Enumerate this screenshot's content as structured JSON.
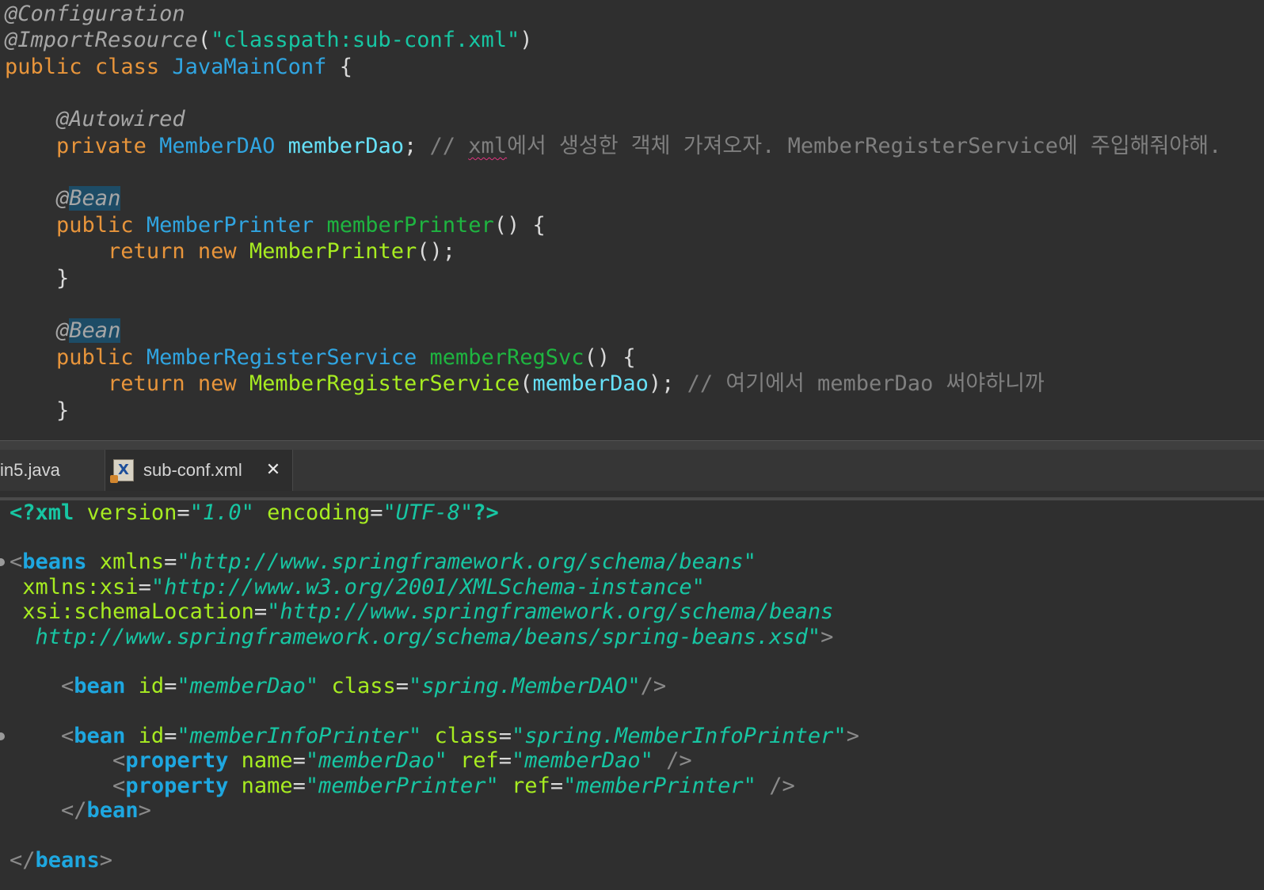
{
  "java": {
    "l1": {
      "ann": "@Configuration"
    },
    "l2": {
      "ann": "@ImportResource",
      "p1": "(",
      "str": "\"classpath:sub-conf.xml\"",
      "p2": ")"
    },
    "l3": {
      "kw1": "public",
      "kw2": "class",
      "type": "JavaMainConf",
      "brace": "{"
    },
    "l4": {
      "ann": "@Autowired"
    },
    "l5": {
      "kw": "private",
      "type": "MemberDAO",
      "fld": "memberDao",
      "semi": ";",
      "cmt_pre": "// ",
      "cmt_squig": "xml",
      "cmt_post": "에서 생성한 객체 가져오자. MemberRegisterService에 주입해줘야해."
    },
    "l6": {
      "at": "@",
      "name": "Bean"
    },
    "l7": {
      "kw": "public",
      "type": "MemberPrinter",
      "mth": "memberPrinter",
      "rest": "() {"
    },
    "l8": {
      "kw1": "return",
      "kw2": "new",
      "ctor": "MemberPrinter",
      "rest": "();"
    },
    "l9": {
      "brace": "}"
    },
    "l10": {
      "at": "@",
      "name": "Bean"
    },
    "l11": {
      "kw": "public",
      "type": "MemberRegisterService",
      "mth": "memberRegSvc",
      "rest": "() {"
    },
    "l12": {
      "kw1": "return",
      "kw2": "new",
      "ctor": "MemberRegisterService",
      "p1": "(",
      "fld": "memberDao",
      "p2": ");",
      "cmt": "// 여기에서 memberDao 써야하니까"
    },
    "l13": {
      "brace": "}"
    }
  },
  "tabs": {
    "inactive_label": "in5.java",
    "active_label": "sub-conf.xml",
    "active_icon": "xml-file-icon",
    "close_icon": "close-icon"
  },
  "xml": {
    "decl": {
      "open": "<?",
      "tag": "xml",
      "a1": "version",
      "v1": "\"1.0\"",
      "a2": "encoding",
      "v2": "\"UTF-8\"",
      "close": "?>"
    },
    "beans_open": {
      "lt": "<",
      "tag": "beans",
      "a1": "xmlns",
      "v1": "\"http://www.springframework.org/schema/beans\""
    },
    "xsi": {
      "a": "xmlns:xsi",
      "v": "\"http://www.w3.org/2001/XMLSchema-instance\""
    },
    "schema": {
      "a": "xsi:schemaLocation",
      "v": "\"http://www.springframework.org/schema/beans"
    },
    "schema2": {
      "v": "http://www.springframework.org/schema/beans/spring-beans.xsd\"",
      "gt": ">"
    },
    "bean1": {
      "lt": "<",
      "tag": "bean",
      "a1": "id",
      "v1": "\"memberDao\"",
      "a2": "class",
      "v2": "\"spring.MemberDAO\"",
      "end": "/>"
    },
    "bean2": {
      "lt": "<",
      "tag": "bean",
      "a1": "id",
      "v1": "\"memberInfoPrinter\"",
      "a2": "class",
      "v2": "\"spring.MemberInfoPrinter\"",
      "gt": ">"
    },
    "prop1": {
      "lt": "<",
      "tag": "property",
      "a1": "name",
      "v1": "\"memberDao\"",
      "a2": "ref",
      "v2": "\"memberDao\"",
      "end": "/>"
    },
    "prop2": {
      "lt": "<",
      "tag": "property",
      "a1": "name",
      "v1": "\"memberPrinter\"",
      "a2": "ref",
      "v2": "\"memberPrinter\"",
      "end": "/>"
    },
    "bean_close": {
      "lt": "</",
      "tag": "bean",
      "gt": ">"
    },
    "beans_close": {
      "lt": "</",
      "tag": "beans",
      "gt": ">"
    }
  },
  "colors": {
    "background": "#2f2f2f",
    "keyword": "#e8953b",
    "type": "#30a5e1",
    "string": "#17c6a3",
    "xml_tag": "#1ea7e0",
    "xml_attr": "#a7ec21"
  }
}
